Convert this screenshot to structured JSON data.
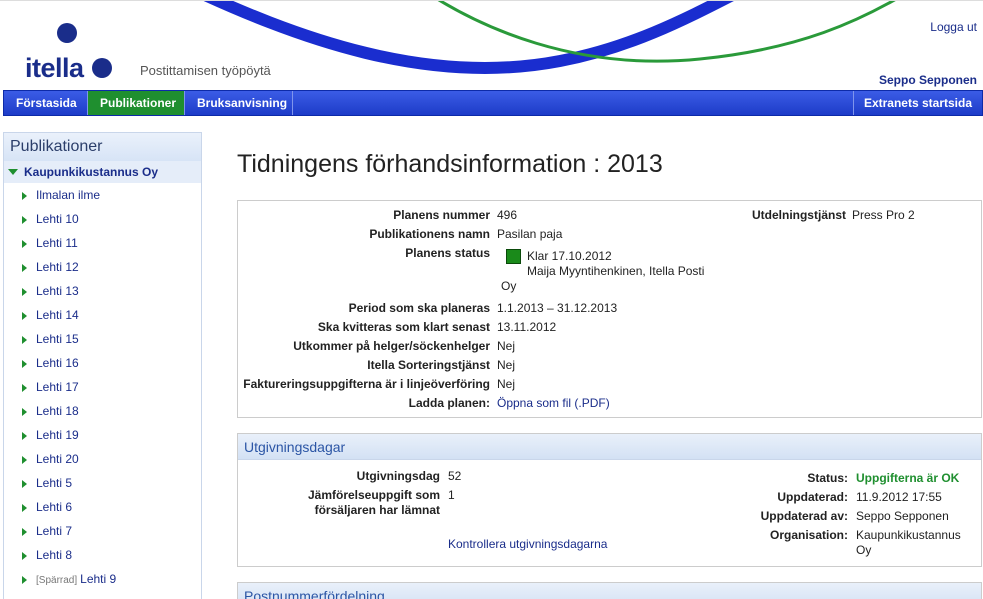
{
  "header": {
    "logo_text": "itella",
    "tagline": "Postittamisen työpöytä",
    "logout": "Logga ut",
    "user": "Seppo Sepponen"
  },
  "nav": {
    "items": [
      "Förstasida",
      "Publikationer",
      "Bruksanvisning"
    ],
    "active": "Publikationer",
    "right": "Extranets startsida"
  },
  "sidebar": {
    "title": "Publikationer",
    "root": "Kaupunkikustannus Oy",
    "items": [
      "Ilmalan ilme",
      "Lehti 10",
      "Lehti 11",
      "Lehti 12",
      "Lehti 13",
      "Lehti 14",
      "Lehti 15",
      "Lehti 16",
      "Lehti 17",
      "Lehti 18",
      "Lehti 19",
      "Lehti 20",
      "Lehti 5",
      "Lehti 6",
      "Lehti 7",
      "Lehti 8"
    ],
    "locked_item": {
      "tag": "[Spärrad]",
      "label": "Lehti 9"
    }
  },
  "page_title": "Tidningens förhandsinformation : 2013",
  "info": {
    "plan_number_label": "Planens nummer",
    "plan_number": "496",
    "pub_name_label": "Publikationens namn",
    "pub_name": "Pasilan paja",
    "plan_status_label": "Planens status",
    "plan_status_line1": "Klar 17.10.2012",
    "plan_status_line2": "Maija Myyntihenkinen, Itella Posti",
    "plan_status_line3": "Oy",
    "status_color": "#1a8a1a",
    "period_label": "Period som ska planeras",
    "period": "1.1.2013 – 31.12.2013",
    "ack_label": "Ska kvitteras som klart senast",
    "ack": "13.11.2012",
    "holidays_label": "Utkommer på helger/söckenhelger",
    "holidays": "Nej",
    "sorting_label": "Itella Sorteringstjänst",
    "sorting": "Nej",
    "billing_label": "Faktureringsuppgifterna är i linjeöverföring",
    "billing": "Nej",
    "download_label": "Ladda planen:",
    "download_link": "Öppna som fil (.PDF)",
    "delivery_label": "Utdelningstjänst",
    "delivery": "Press Pro 2"
  },
  "utgivning": {
    "title": "Utgivningsdagar",
    "days_label": "Utgivningsdag",
    "days": "52",
    "compare_label_1": "Jämförelseuppgift som",
    "compare_label_2": "försäljaren har lämnat",
    "compare": "1",
    "check_link": "Kontrollera utgivningsdagarna",
    "status_label": "Status:",
    "status": "Uppgifterna är OK",
    "updated_label": "Uppdaterad:",
    "updated": "11.9.2012 17:55",
    "updated_by_label": "Uppdaterad av:",
    "updated_by": "Seppo Sepponen",
    "org_label": "Organisation:",
    "org_line1": "Kaupunkikustannus",
    "org_line2": "Oy"
  },
  "postnummer": {
    "title": "Postnummerfördelning"
  }
}
